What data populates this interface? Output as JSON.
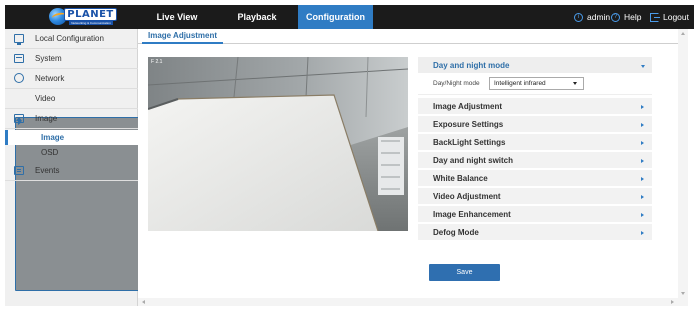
{
  "logo": {
    "word": "PLANET",
    "tagline": "Networking & Communication"
  },
  "nav": {
    "tabs": [
      {
        "label": "Live View"
      },
      {
        "label": "Playback"
      },
      {
        "label": "Configuration"
      }
    ],
    "user": "admin",
    "help": "Help",
    "logout": "Logout"
  },
  "sidebar": {
    "items": [
      {
        "label": "Local Configuration",
        "icon": "monitor-icon"
      },
      {
        "label": "System",
        "icon": "system-icon"
      },
      {
        "label": "Network",
        "icon": "globe-icon"
      },
      {
        "label": "Video",
        "icon": "video-icon"
      },
      {
        "label": "Image",
        "icon": "image-icon"
      },
      {
        "label": "Events",
        "icon": "events-icon"
      }
    ],
    "image_subitems": [
      {
        "label": "Image",
        "active": true
      },
      {
        "label": "OSD",
        "active": false
      }
    ]
  },
  "main": {
    "tab": "Image Adjustment",
    "video_timestamp": "F 2.1"
  },
  "panel": {
    "open_section": {
      "title": "Day and night mode",
      "field_label": "Day/Night mode",
      "field_value": "Intelligent infrared"
    },
    "sections": [
      "Image Adjustment",
      "Exposure Settings",
      "BackLight Settings",
      "Day and night switch",
      "White Balance",
      "Video Adjustment",
      "Image Enhancement",
      "Defog Mode"
    ],
    "save_label": "Save"
  },
  "colors": {
    "accent": "#2f7cc4",
    "topbar": "#1b1b1b",
    "sidebar_bg": "#f0f0f0",
    "save_button": "#2f6fb0"
  }
}
